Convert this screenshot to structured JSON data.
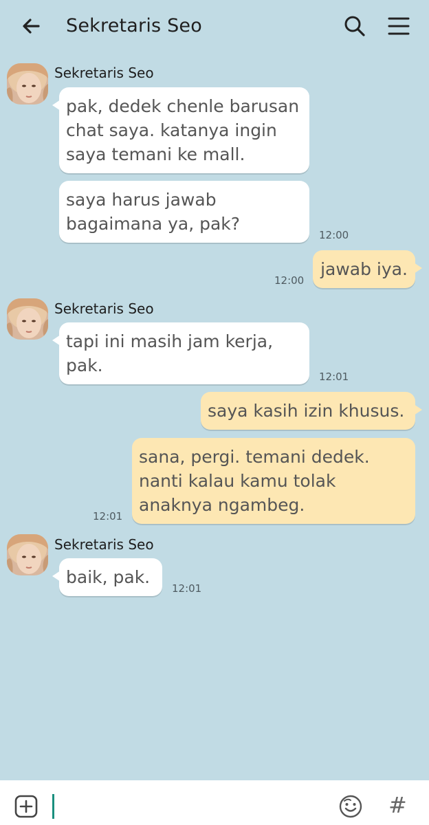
{
  "header": {
    "title": "Sekretaris Seo"
  },
  "messages": [
    {
      "sender": "Sekretaris Seo",
      "bubbles": [
        {
          "text": "pak, dedek chenle barusan chat saya. katanya ingin saya temani ke mall."
        },
        {
          "text": "saya harus jawab bagaimana ya, pak?"
        }
      ],
      "time": "12:00"
    },
    {
      "sender": "me",
      "text": "jawab iya.",
      "time": "12:00"
    },
    {
      "sender": "Sekretaris Seo",
      "text": "tapi ini masih jam kerja, pak.",
      "time": "12:01"
    },
    {
      "sender": "me",
      "bubbles": [
        {
          "text": "saya kasih izin khusus."
        },
        {
          "text": "sana, pergi. temani dedek. nanti kalau kamu tolak anaknya ngambeg."
        }
      ],
      "time": "12:01"
    },
    {
      "sender": "Sekretaris Seo",
      "text": "baik, pak.",
      "time": "12:01"
    }
  ],
  "input": {
    "hash_label": "#"
  },
  "colors": {
    "background": "#c1dbe4",
    "incoming_bubble": "#ffffff",
    "outgoing_bubble": "#fde7b3",
    "caret": "#1a8f7e"
  }
}
